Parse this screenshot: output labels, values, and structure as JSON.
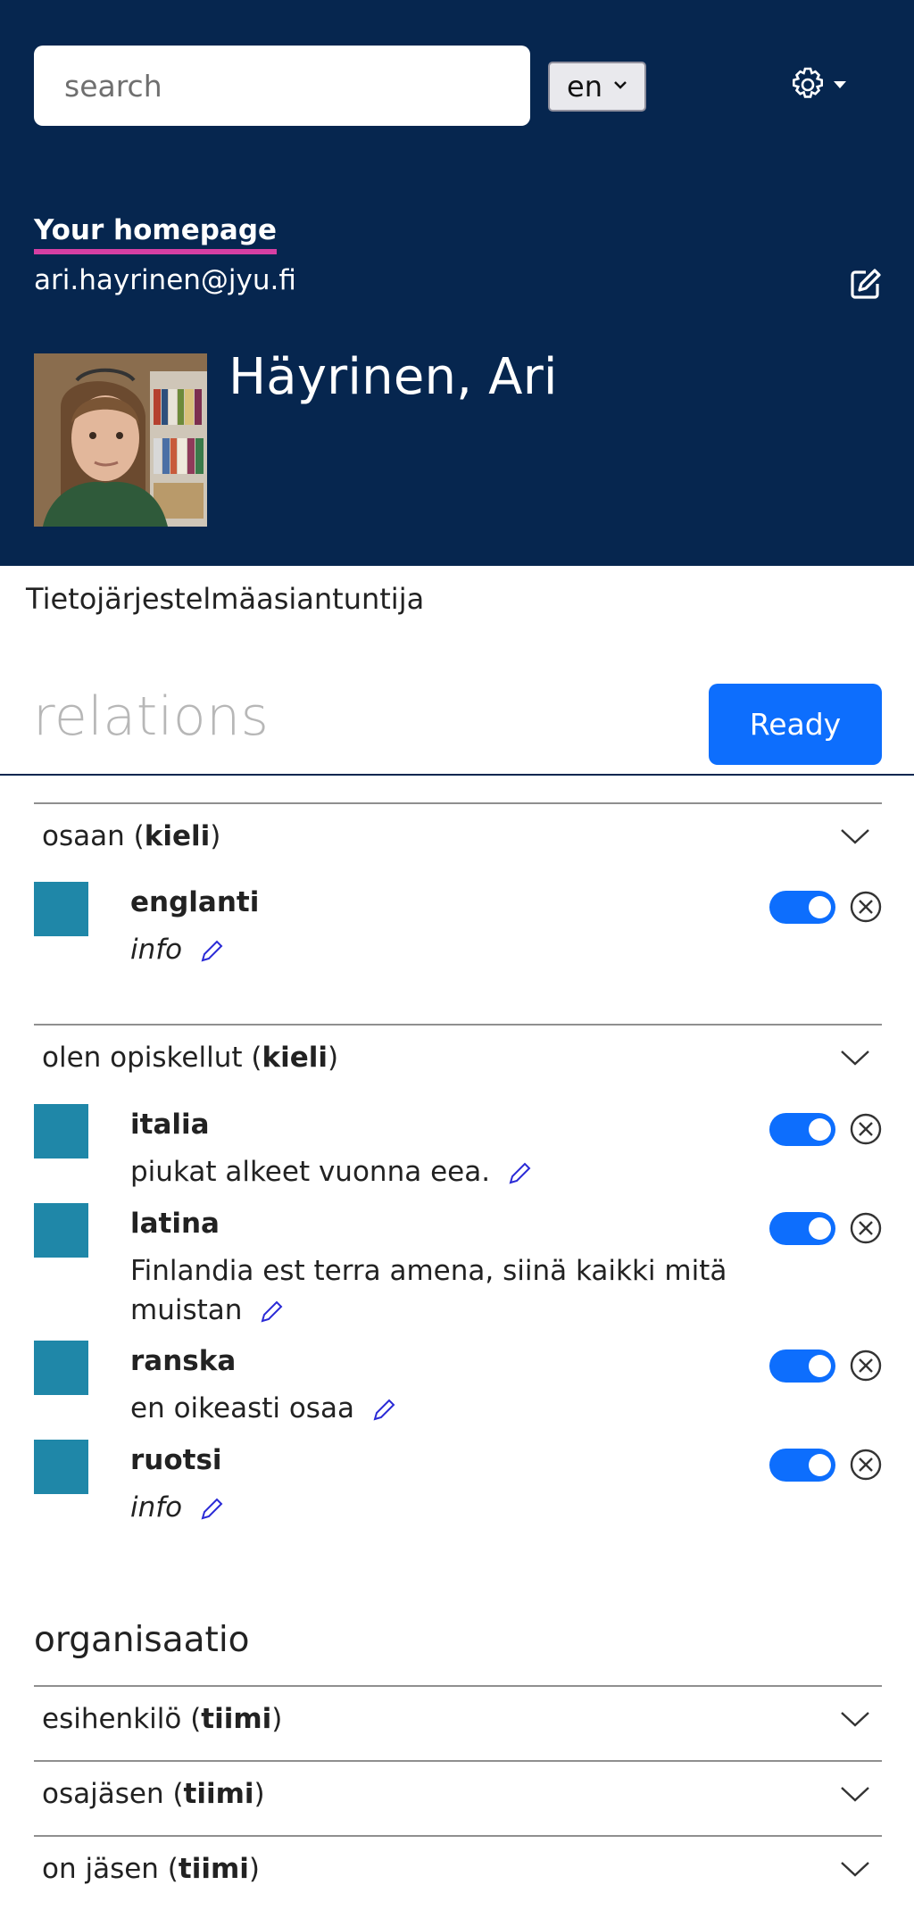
{
  "header": {
    "search_placeholder": "search",
    "language": "en",
    "homepage_link": "Your homepage",
    "email": "ari.hayrinen@jyu.fi",
    "name": "Häyrinen, Ari",
    "colors": {
      "background": "#06264f",
      "accent_underline": "#d63fa3"
    },
    "icons": {
      "settings": "gear-icon",
      "edit": "edit-icon"
    }
  },
  "profile": {
    "job_title": "Tietojärjestelmäasiantuntija"
  },
  "relations": {
    "heading": "relations",
    "ready_label": "Ready",
    "groups": [
      {
        "relation": "osaan (",
        "type": "kieli",
        "close": ")",
        "items": [
          {
            "name": "englanti",
            "info": "info",
            "enabled": true
          }
        ]
      },
      {
        "relation": "olen opiskellut (",
        "type": "kieli",
        "close": ")",
        "items": [
          {
            "name": "italia",
            "info": "piukat alkeet vuonna eea.",
            "enabled": true
          },
          {
            "name": "latina",
            "info": "Finlandia est terra amena, siinä kaikki mitä muistan",
            "enabled": true
          },
          {
            "name": "ranska",
            "info": "en oikeasti osaa",
            "enabled": true
          },
          {
            "name": "ruotsi",
            "info": "info",
            "enabled": true
          }
        ]
      }
    ]
  },
  "organisation": {
    "heading": "organisaatio",
    "groups": [
      {
        "relation": "esihenkilö (",
        "type": "tiimi",
        "close": ")"
      },
      {
        "relation": "osajäsen (",
        "type": "tiimi",
        "close": ")"
      },
      {
        "relation": "on jäsen (",
        "type": "tiimi",
        "close": ")"
      }
    ]
  }
}
